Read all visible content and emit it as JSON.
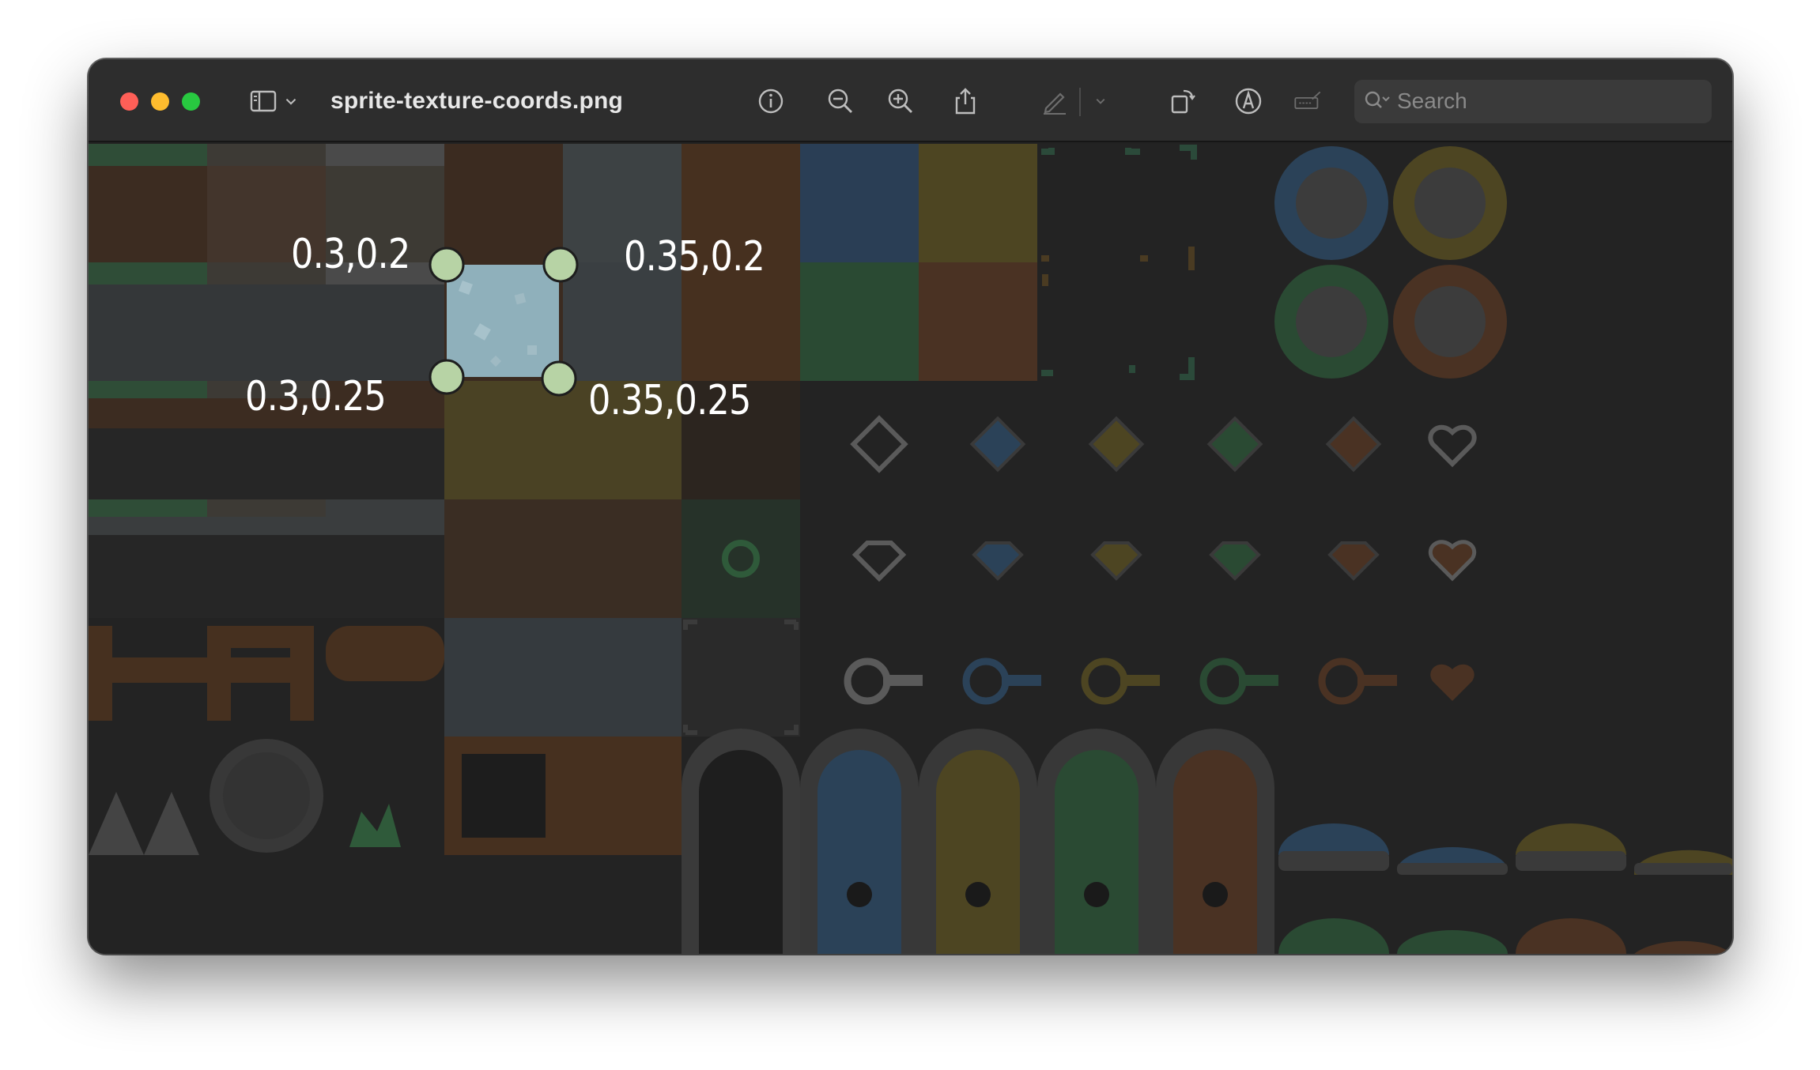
{
  "window": {
    "title": "sprite-texture-coords.png"
  },
  "toolbar": {
    "sidebar_icon": "sidebar-toggle-icon",
    "chevron_icon": "chevron-down-icon",
    "info_icon": "info-icon",
    "zoom_out_icon": "zoom-out-icon",
    "zoom_in_icon": "zoom-in-icon",
    "share_icon": "share-icon",
    "markup_icon": "pen-icon",
    "rotate_icon": "rotate-icon",
    "annotate_icon": "markup-circle-icon",
    "sign_icon": "signature-icon",
    "search_placeholder": "Search"
  },
  "annotations": {
    "top_left": "0.3,0.2",
    "top_right": "0.35,0.2",
    "bottom_left": "0.3,0.25",
    "bottom_right": "0.35,0.25"
  },
  "colors": {
    "close": "#fe5f57",
    "minimize": "#febc2e",
    "maximize": "#28c840",
    "handle": "#b7d3a5",
    "selection": "#8fb0bb"
  }
}
